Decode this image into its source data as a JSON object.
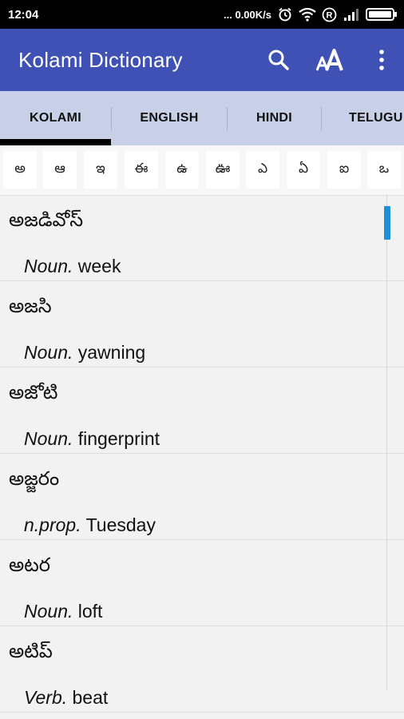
{
  "status_bar": {
    "time": "12:04",
    "net_speed": "... 0.00K/s",
    "icons": [
      "alarm-icon",
      "wifi-icon",
      "registered-icon",
      "signal-icon",
      "battery-icon"
    ]
  },
  "app_bar": {
    "title": "Kolami Dictionary",
    "actions": [
      "search-icon",
      "text-size-icon",
      "more-vert-icon"
    ],
    "color": "#3f51b5"
  },
  "tabs": [
    {
      "label": "KOLAMI",
      "selected": true
    },
    {
      "label": "ENGLISH",
      "selected": false
    },
    {
      "label": "HINDI",
      "selected": false
    },
    {
      "label": "TELUGU",
      "selected": false
    }
  ],
  "letters": [
    "అ",
    "ఆ",
    "ఇ",
    "ఈ",
    "ఉ",
    "ఊ",
    "ఎ",
    "ఏ",
    "ఐ",
    "ఒ"
  ],
  "entries": [
    {
      "word": "అజడివోస్",
      "pos": "Noun.",
      "meaning": "week"
    },
    {
      "word": "అజసి",
      "pos": "Noun.",
      "meaning": "yawning"
    },
    {
      "word": "అజోటి",
      "pos": "Noun.",
      "meaning": "fingerprint"
    },
    {
      "word": "అజ్జరం",
      "pos": "n.prop.",
      "meaning": "Tuesday"
    },
    {
      "word": "అటర",
      "pos": "Noun.",
      "meaning": "loft"
    },
    {
      "word": "అటిప్",
      "pos": "Verb.",
      "meaning": "beat"
    }
  ],
  "colors": {
    "accent": "#1e90d8",
    "tab_bar": "#c8d0e8"
  }
}
